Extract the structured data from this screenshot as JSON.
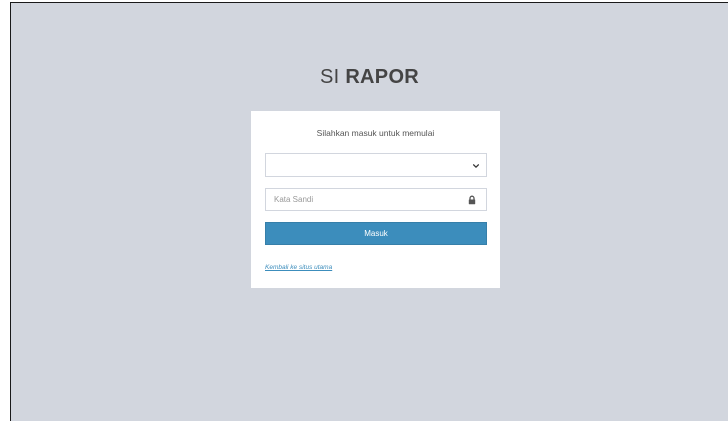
{
  "logo": {
    "light_text": "SI ",
    "bold_text": "RAPOR"
  },
  "login_box": {
    "message": "Silahkan masuk untuk memulai",
    "username_select": {
      "selected_value": ""
    },
    "password": {
      "placeholder": "Kata Sandi",
      "icon": "lock-icon"
    },
    "submit_label": "Masuk",
    "back_link_label": "Kembali ke situs utama"
  },
  "colors": {
    "background": "#d2d6de",
    "button": "#3c8dbc",
    "link": "#3c8dbc"
  }
}
